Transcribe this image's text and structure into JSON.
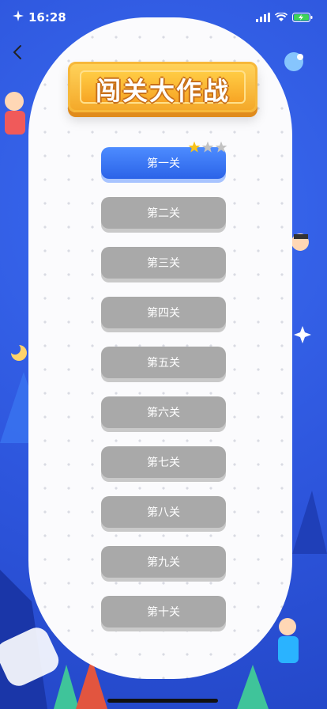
{
  "status_bar": {
    "time": "16:28",
    "icons": [
      "sparkle-icon",
      "signal-icon",
      "wifi-icon",
      "battery-charging-icon"
    ]
  },
  "nav": {
    "back_icon": "chevron-left-icon"
  },
  "title": "闯关大作战",
  "colors": {
    "background": "#2f5be0",
    "panel": "#fbfbfd",
    "active_button": "#2b63e8",
    "locked_button": "#a9a9a9",
    "title_plate": "#f7a525",
    "star_earned": "#f7c21b",
    "star_empty": "#c2c2c2"
  },
  "levels": [
    {
      "label": "第一关",
      "active": true,
      "stars_earned": 1,
      "stars_total": 3
    },
    {
      "label": "第二关",
      "active": false
    },
    {
      "label": "第三关",
      "active": false
    },
    {
      "label": "第四关",
      "active": false
    },
    {
      "label": "第五关",
      "active": false
    },
    {
      "label": "第六关",
      "active": false
    },
    {
      "label": "第七关",
      "active": false
    },
    {
      "label": "第八关",
      "active": false
    },
    {
      "label": "第九关",
      "active": false
    },
    {
      "label": "第十关",
      "active": false
    }
  ]
}
